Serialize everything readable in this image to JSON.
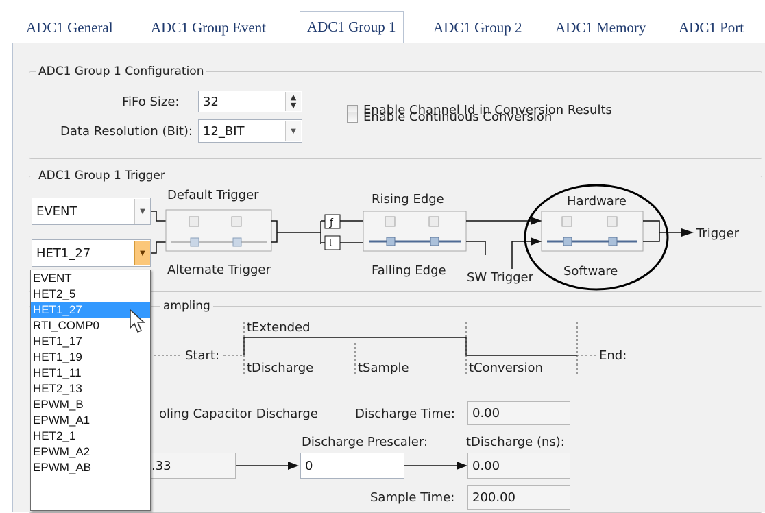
{
  "tabs": [
    {
      "label": "ADC1 General"
    },
    {
      "label": "ADC1 Group Event"
    },
    {
      "label": "ADC1 Group 1"
    },
    {
      "label": "ADC1 Group 2"
    },
    {
      "label": "ADC1 Memory"
    },
    {
      "label": "ADC1 Port"
    }
  ],
  "active_tab": "ADC1 Group 1",
  "config": {
    "legend": "ADC1 Group 1 Configuration",
    "fifo_label": "FiFo Size:",
    "fifo_value": "32",
    "resolution_label": "Data Resolution (Bit):",
    "resolution_value": "12_BIT",
    "channel_id_label": "Enable Channel Id in Conversion Results",
    "continuous_label": "Enable Continuous Conversion"
  },
  "trigger": {
    "legend": "ADC1 Group 1 Trigger",
    "default_select": "EVENT",
    "alternate_select": "HET1_27",
    "default_trigger": "Default Trigger",
    "alternate_trigger": "Alternate Trigger",
    "rising_edge": "Rising Edge",
    "falling_edge": "Falling Edge",
    "sw_trigger": "SW Trigger",
    "hardware": "Hardware",
    "software": "Software",
    "output": "Trigger"
  },
  "dropdown": {
    "options": [
      "EVENT",
      "HET2_5",
      "HET1_27",
      "RTI_COMP0",
      "HET1_17",
      "HET1_19",
      "HET1_11",
      "HET2_13",
      "EPWM_B",
      "EPWM_A1",
      "HET2_1",
      "EPWM_A2",
      "EPWM_AB"
    ],
    "selected_index": 2
  },
  "sampling": {
    "legend_partial": "ampling",
    "start": "Start:",
    "end": "End:",
    "t_extended": "tExtended",
    "t_discharge": "tDischarge",
    "t_sample": "tSample",
    "t_conversion": "tConversion",
    "discharge_partial": "oling Capacitor Discharge",
    "discharge_time_label": "Discharge Time:",
    "discharge_time_value": "0.00",
    "discharge_prescaler_label": "Discharge Prescaler:",
    "tdischarge_ns_label": "tDischarge (ns):",
    "left_value_partial": ".33",
    "prescaler_value": "0",
    "tdischarge_ns_value": "0.00",
    "sample_time_label": "Sample Time:",
    "sample_time_value": "200.00"
  }
}
